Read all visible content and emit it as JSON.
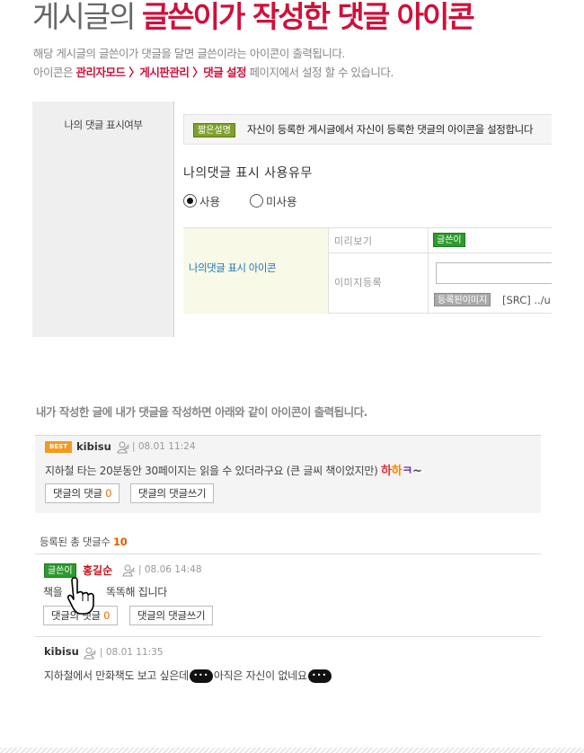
{
  "header": {
    "title_prefix": "게시글의 ",
    "title_highlight": "글쓴이가 작성한 댓글 아이콘",
    "desc_line1": "해당 게시글의 글쓴이가 댓글을 달면 글쓴이라는 아이콘이 출력됩니다.",
    "desc_line2_prefix": "아이콘은 ",
    "desc_line2_path": "관리자모드 〉게시판관리 〉댓글 설정",
    "desc_line2_suffix": " 페이지에서 설정 할 수 있습니다."
  },
  "admin": {
    "side_label": "나의 댓글 표시여부",
    "tip_badge": "짧은설명",
    "tip_text": "자신이 등록한 게시글에서 자신이 등록한 댓글의 아이콘을 설정합니다",
    "setting_title": "나의댓글 표시 사용유무",
    "radio_use": "사용",
    "radio_nouse": "미사용",
    "icon_row_label": "나의댓글 표시 아이콘",
    "preview_label": "미리보기",
    "preview_icon": "글쓴이",
    "image_label": "이미지등록",
    "registered_btn": "등록된이미지",
    "src_text": "[SRC] ../u"
  },
  "caption": "내가 작성한 글에 내가 댓글을 작성하면 아래와 같이 아이콘이 출력됩니다.",
  "best_comment": {
    "badge": "BEST",
    "author": "kibisu",
    "date": "| 08.01 11:24",
    "text": "지하철 타는 20분동안 30페이지는 읽을 수 있더라구요 (큰 글씨 책이었지만)",
    "emote_1": "하",
    "emote_2": "하",
    "emote_3": "ㅋ",
    "emote_tilde": "~",
    "reply_btn_label": "댓글의 댓글 ",
    "reply_count": "0",
    "write_btn_label": "댓글의 댓글쓰기"
  },
  "total": {
    "label": "등록된 총 댓글수 ",
    "count": "10"
  },
  "comments": [
    {
      "icon": "글쓴이",
      "author": "홍길순",
      "date": "| 08.06 14:48",
      "text_before": "책을",
      "text_after": "똑똑해 집니다",
      "reply_btn_label": "댓글의 댓글 ",
      "reply_count": "0",
      "write_btn_label": "댓글의 댓글쓰기"
    },
    {
      "author": "kibisu",
      "date": "| 08.01 11:35",
      "text_part1": "지하철에서 만화책도 보고 싶은데",
      "text_part2": "아직은 자신이 없네요"
    }
  ],
  "colors": {
    "accent_red": "#d0103a",
    "author_icon_green": "#2e9a2e",
    "best_orange": "#f39a1d",
    "count_orange": "#e65a00",
    "link_blue": "#1a78c2"
  },
  "icons": [
    "user-icon",
    "pointer-hand-icon",
    "speech-bubble-icon"
  ]
}
